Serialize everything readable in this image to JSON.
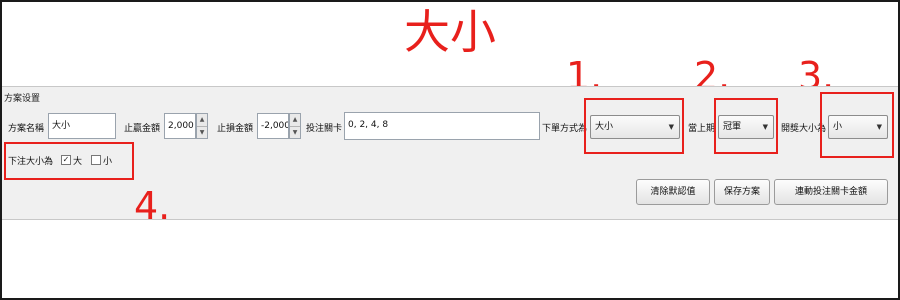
{
  "title": "大小",
  "panel": {
    "section_title": "方案设置",
    "plan_name": {
      "label": "方案名稱",
      "value": "大小"
    },
    "take_profit": {
      "label": "止贏金額",
      "value": "2,000"
    },
    "stop_loss": {
      "label": "止損金額",
      "value": "-2,000"
    },
    "bet_level": {
      "label": "投注關卡",
      "value": "0, 2, 4, 8"
    },
    "order_mode": {
      "label": "下單方式為",
      "value": "大小"
    },
    "current_period": {
      "label": "當上期",
      "value": "冠軍"
    },
    "open_size": {
      "label": "開獎大小為",
      "value": "小"
    },
    "bet_size": {
      "label": "下注大小為",
      "options": [
        {
          "label": "大",
          "checked": true
        },
        {
          "label": "小",
          "checked": false
        }
      ]
    },
    "buttons": {
      "clear_default": "清除默認值",
      "save_plan": "保存方案",
      "link_bet_amount": "連動投注關卡金額"
    }
  },
  "annotations": {
    "n1": "1.",
    "n2": "2.",
    "n3": "3.",
    "n4": "4."
  },
  "colors": {
    "annotation_red": "#e8201c",
    "panel_bg": "#f0f0f0"
  },
  "icons": {
    "spin_up": "arrow-up-icon",
    "spin_down": "arrow-down-icon",
    "dropdown": "dropdown-arrow-icon",
    "check": "checkmark-icon"
  }
}
